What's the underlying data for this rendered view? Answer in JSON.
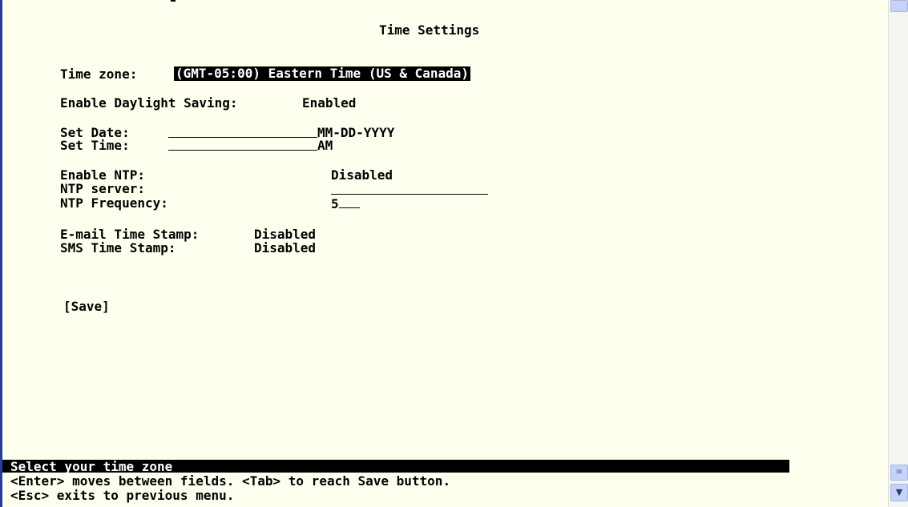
{
  "screen": {
    "title": "Time Settings"
  },
  "fields": {
    "time_zone_label": "Time zone:",
    "time_zone_value": "(GMT-05:00) Eastern Time (US & Canada)",
    "daylight_label": "Enable Daylight Saving:",
    "daylight_value": "Enabled",
    "set_date_label": "Set Date:",
    "set_date_hint": "MM-DD-YYYY",
    "set_time_label": "Set Time:",
    "set_time_hint": "AM",
    "ntp_enable_label": "Enable NTP:",
    "ntp_enable_value": "Disabled",
    "ntp_server_label": "NTP server:",
    "ntp_server_value": "",
    "ntp_frequency_label": "NTP Frequency:",
    "ntp_frequency_value": "5",
    "email_stamp_label": "E-mail Time Stamp:",
    "email_stamp_value": "Disabled",
    "sms_stamp_label": "SMS Time Stamp:",
    "sms_stamp_value": "Disabled"
  },
  "actions": {
    "save_label": "[Save]"
  },
  "status": {
    "prompt": "Select your time zone",
    "hint_line_1": "<Enter> moves between fields. <Tab> to reach Save button.",
    "hint_line_2": "<Esc> exits to previous menu."
  },
  "icons": {
    "scroll_grip": "scroll-grip-icon",
    "scroll_down": "scroll-down-arrow-icon"
  },
  "colors": {
    "background": "#fffff0",
    "text": "#000000",
    "highlight_bg": "#000000",
    "highlight_fg": "#ffffff",
    "scrollbar": "#c6d3f7"
  }
}
